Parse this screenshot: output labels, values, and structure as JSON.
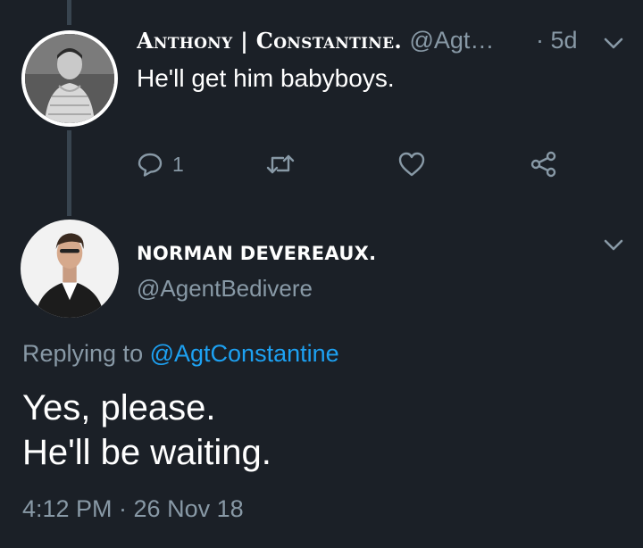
{
  "tweet1": {
    "display_name": "Anthony | Constantine.",
    "handle": "@Agt…",
    "time": "· 5d",
    "text": "He'll get him babyboys.",
    "reply_count": "1"
  },
  "tweet2": {
    "display_name": "NORMAN DEVEREAUX.",
    "handle": "@AgentBedivere",
    "replying_prefix": "Replying to",
    "replying_to": "@AgtConstantine",
    "text_line1": "Yes, please.",
    "text_line2": "He'll be waiting.",
    "timestamp": "4:12 PM · 26 Nov 18"
  },
  "icons": {
    "reply": "reply-icon",
    "retweet": "retweet-icon",
    "like": "heart-icon",
    "share": "share-icon",
    "more": "chevron-down-icon"
  },
  "colors": {
    "background": "#1b2027",
    "thread_line": "#38444f",
    "secondary_text": "#8899a6",
    "link": "#1da1f2",
    "primary_text": "#ffffff"
  }
}
